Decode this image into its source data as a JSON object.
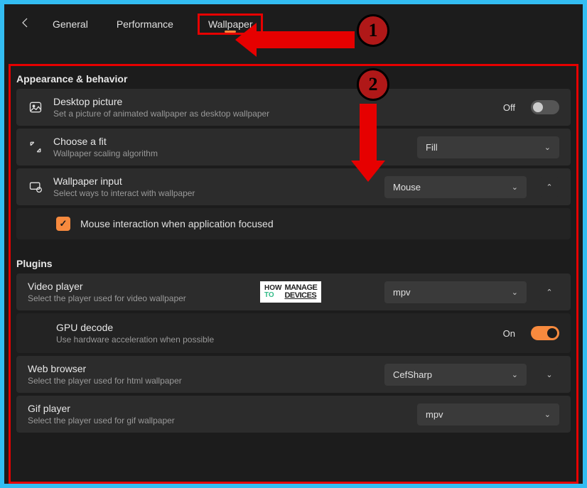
{
  "tabs": {
    "general": "General",
    "performance": "Performance",
    "wallpaper": "Wallpaper"
  },
  "sections": {
    "appearance": "Appearance & behavior",
    "plugins": "Plugins"
  },
  "rows": {
    "desktop_picture": {
      "title": "Desktop picture",
      "subtitle": "Set a picture of animated wallpaper as desktop wallpaper",
      "toggle_label": "Off"
    },
    "choose_fit": {
      "title": "Choose a fit",
      "subtitle": "Wallpaper scaling algorithm",
      "value": "Fill"
    },
    "wallpaper_input": {
      "title": "Wallpaper input",
      "subtitle": "Select ways to interact with wallpaper",
      "value": "Mouse",
      "checkbox_label": "Mouse interaction when application focused"
    },
    "video_player": {
      "title": "Video player",
      "subtitle": "Select the player used for video wallpaper",
      "value": "mpv"
    },
    "gpu_decode": {
      "title": "GPU decode",
      "subtitle": "Use hardware acceleration when possible",
      "toggle_label": "On"
    },
    "web_browser": {
      "title": "Web browser",
      "subtitle": "Select the player used for html wallpaper",
      "value": "CefSharp"
    },
    "gif_player": {
      "title": "Gif player",
      "subtitle": "Select the player used for gif wallpaper",
      "value": "mpv"
    }
  },
  "annotations": {
    "badge1": "1",
    "badge2": "2"
  },
  "watermark": {
    "how": "HOW",
    "to": "TO",
    "main1": "MANAGE",
    "main2": "DEVICES"
  }
}
